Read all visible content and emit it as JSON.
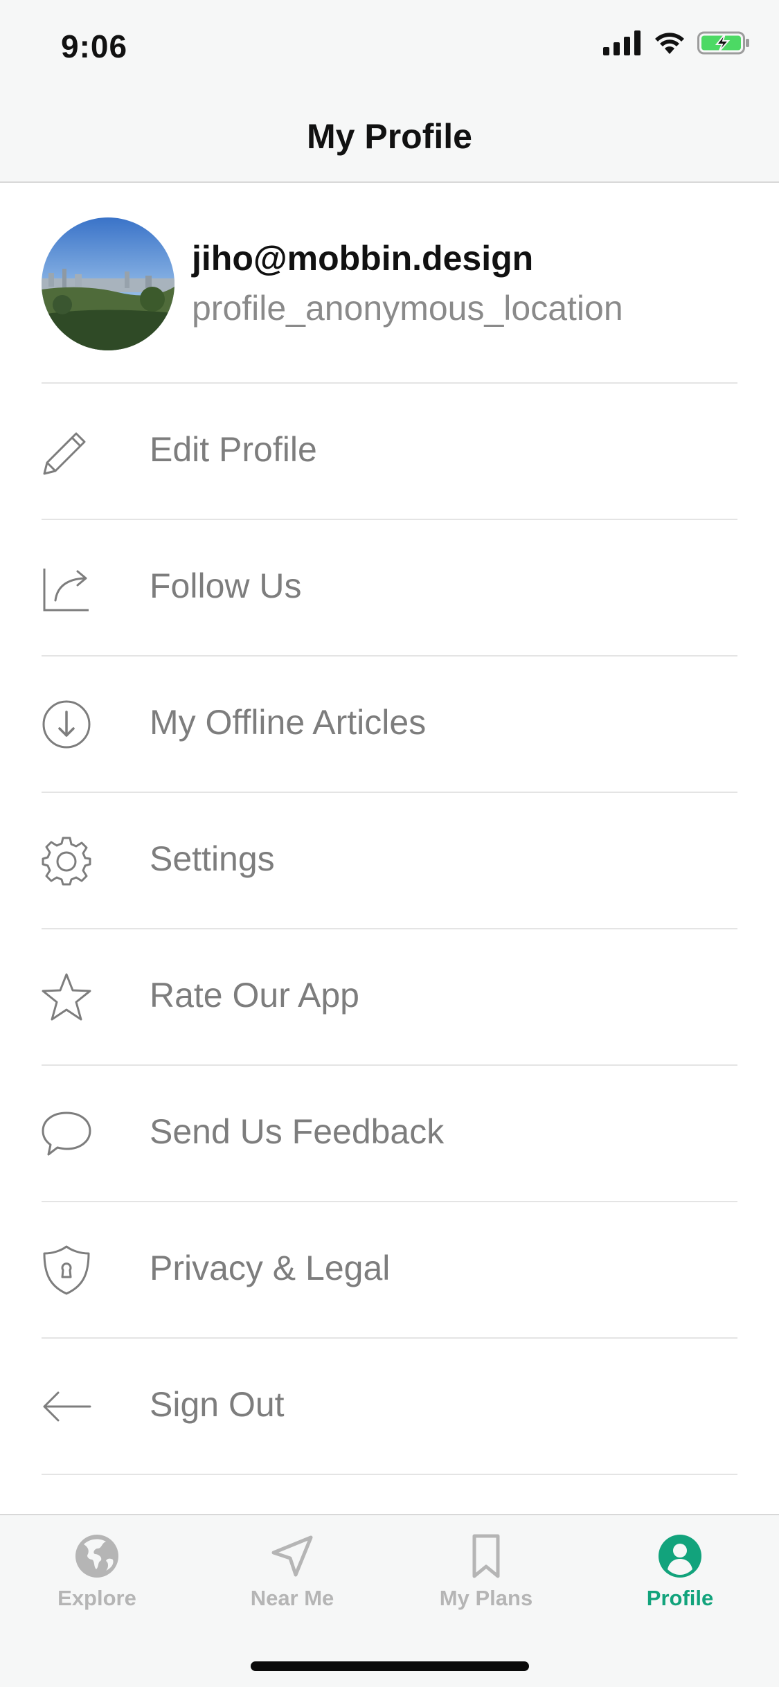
{
  "status_bar": {
    "time": "9:06"
  },
  "header": {
    "title": "My Profile"
  },
  "profile": {
    "email": "jiho@mobbin.design",
    "location": "profile_anonymous_location"
  },
  "menu": [
    {
      "label": "Edit Profile",
      "icon": "pencil-icon"
    },
    {
      "label": "Follow Us",
      "icon": "share-arrow-icon"
    },
    {
      "label": "My Offline Articles",
      "icon": "download-circle-icon"
    },
    {
      "label": "Settings",
      "icon": "gear-icon"
    },
    {
      "label": "Rate Our App",
      "icon": "star-icon"
    },
    {
      "label": "Send Us Feedback",
      "icon": "speech-bubble-icon"
    },
    {
      "label": "Privacy & Legal",
      "icon": "shield-lock-icon"
    },
    {
      "label": "Sign Out",
      "icon": "arrow-left-icon"
    }
  ],
  "tabbar": {
    "tabs": [
      {
        "label": "Explore",
        "icon": "globe-icon",
        "active": false
      },
      {
        "label": "Near Me",
        "icon": "location-arrow-icon",
        "active": false
      },
      {
        "label": "My Plans",
        "icon": "bookmark-icon",
        "active": false
      },
      {
        "label": "Profile",
        "icon": "person-circle-icon",
        "active": true
      }
    ]
  },
  "colors": {
    "accent": "#12a37c",
    "battery": "#4cd964",
    "inactive_tab": "#b5b5b5",
    "menu_text": "#7d7d7d"
  }
}
